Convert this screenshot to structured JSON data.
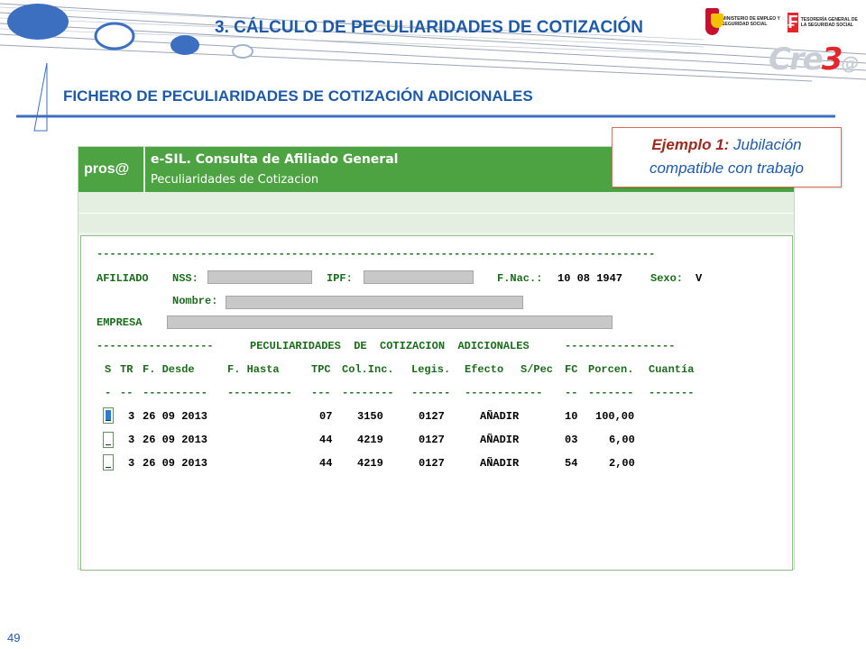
{
  "slide": {
    "title": "3.  CÁLCULO DE PECULIARIDADES DE COTIZACIÓN",
    "subtitle": "FICHERO DE PECULIARIDADES DE COTIZACIÓN ADICIONALES",
    "page_number": "49"
  },
  "logos": {
    "ministerio_text": "MINISTERIO DE EMPLEO Y SEGURIDAD SOCIAL",
    "tgss_text": "TESORERÍA GENERAL DE LA SEGURIDAD SOCIAL",
    "cre_text": "Cre",
    "cre_three": "3",
    "cre_at": "@"
  },
  "callout": {
    "label": "Ejemplo 1:",
    "text_line1": " Jubilación",
    "text_line2": "compatible con trabajo"
  },
  "app": {
    "logo": "pros@",
    "title": "e-SIL. Consulta de Afiliado General",
    "subtitle": "Peculiaridades de Cotizacion"
  },
  "form": {
    "separator_top": "--------------------------------------------------------------------------------------",
    "afiliado_label": "AFILIADO",
    "nss_label": "NSS:",
    "ipf_label": "IPF:",
    "fnac_label": "F.Nac.:",
    "fnac_value": "10 08 1947",
    "sexo_label": "Sexo:",
    "sexo_value": "V",
    "nombre_label": "Nombre:",
    "empresa_label": "EMPRESA",
    "section_left_dashes": "------------------",
    "section_title": "PECULIARIDADES  DE  COTIZACION  ADICIONALES",
    "section_right_dashes": "-----------------"
  },
  "table": {
    "headers": [
      "S",
      "TR",
      "F. Desde",
      "F. Hasta",
      "TPC",
      "Col.Inc.",
      "Legis.",
      "Efecto",
      "S/Pec",
      "FC",
      "Porcen.",
      "Cuantía"
    ],
    "header_dashes": [
      "-",
      "--",
      "----------",
      "----------",
      "---",
      "--------",
      "------",
      "------------",
      "--",
      "-------",
      "-------"
    ],
    "rows": [
      {
        "tr": "3",
        "f_desde": "26 09 2013",
        "tpc": "07",
        "col_inc": "3150",
        "legis": "0127",
        "efecto": "AÑADIR",
        "fc": "10",
        "porcen": "100,00"
      },
      {
        "tr": "3",
        "f_desde": "26 09 2013",
        "tpc": "44",
        "col_inc": "4219",
        "legis": "0127",
        "efecto": "AÑADIR",
        "fc": "03",
        "porcen": "6,00"
      },
      {
        "tr": "3",
        "f_desde": "26 09 2013",
        "tpc": "44",
        "col_inc": "4219",
        "legis": "0127",
        "efecto": "AÑADIR",
        "fc": "54",
        "porcen": "2,00"
      }
    ]
  },
  "colors": {
    "title_blue": "#1f5aa8",
    "app_green": "#4da342",
    "text_green": "#1c6b1c",
    "callout_border": "#d96c5a"
  }
}
